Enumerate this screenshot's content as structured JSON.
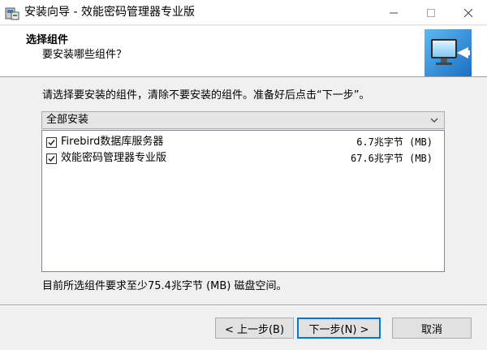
{
  "window": {
    "title": "安装向导 - 效能密码管理器专业版",
    "icon": "installer-icon",
    "controls": [
      "minimize-icon",
      "maximize-icon",
      "close-icon"
    ]
  },
  "header": {
    "title": "选择组件",
    "subtitle": "要安装哪些组件？",
    "image": "computer-install-icon"
  },
  "instruction": "请选择要安装的组件，清除不要安装的组件。准备好后点击“下一步”。",
  "combo": {
    "selected": "全部安装"
  },
  "components": [
    {
      "name": "Firebird数据库服务器",
      "size": "6.7兆字节 (MB)",
      "checked": true
    },
    {
      "name": "效能密码管理器专业版",
      "size": "67.6兆字节 (MB)",
      "checked": true
    }
  ],
  "space_required": "目前所选组件要求至少75.4兆字节 (MB) 磁盘空间。",
  "buttons": {
    "back": "< 上一步(B)",
    "next": "下一步(N) >",
    "cancel": "取消"
  },
  "colors": {
    "focus": "#0078d7",
    "header_bg": "#ffffff",
    "dialog_bg": "#f0f0f0"
  }
}
